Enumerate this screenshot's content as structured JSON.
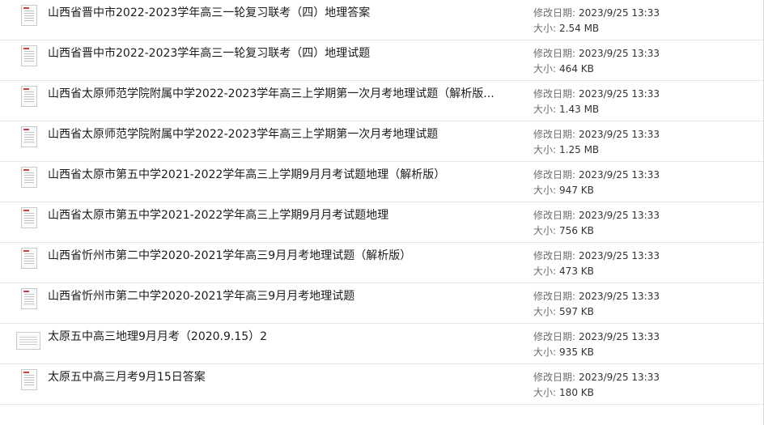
{
  "labels": {
    "modified": "修改日期:",
    "size": "大小:"
  },
  "files": [
    {
      "name": "山西省晋中市2022-2023学年高三一轮复习联考（四）地理答案",
      "modified": "2023/9/25 13:33",
      "size": "2.54 MB",
      "thumb": "page"
    },
    {
      "name": "山西省晋中市2022-2023学年高三一轮复习联考（四）地理试题",
      "modified": "2023/9/25 13:33",
      "size": "464 KB",
      "thumb": "page"
    },
    {
      "name": "山西省太原师范学院附属中学2022-2023学年高三上学期第一次月考地理试题（解析版...",
      "modified": "2023/9/25 13:33",
      "size": "1.43 MB",
      "thumb": "page"
    },
    {
      "name": "山西省太原师范学院附属中学2022-2023学年高三上学期第一次月考地理试题",
      "modified": "2023/9/25 13:33",
      "size": "1.25 MB",
      "thumb": "page"
    },
    {
      "name": "山西省太原市第五中学2021-2022学年高三上学期9月月考试题地理（解析版）",
      "modified": "2023/9/25 13:33",
      "size": "947 KB",
      "thumb": "page"
    },
    {
      "name": "山西省太原市第五中学2021-2022学年高三上学期9月月考试题地理",
      "modified": "2023/9/25 13:33",
      "size": "756 KB",
      "thumb": "page"
    },
    {
      "name": "山西省忻州市第二中学2020-2021学年高三9月月考地理试题（解析版）",
      "modified": "2023/9/25 13:33",
      "size": "473 KB",
      "thumb": "page"
    },
    {
      "name": "山西省忻州市第二中学2020-2021学年高三9月月考地理试题",
      "modified": "2023/9/25 13:33",
      "size": "597 KB",
      "thumb": "page"
    },
    {
      "name": "太原五中高三地理9月月考（2020.9.15）2",
      "modified": "2023/9/25 13:33",
      "size": "935 KB",
      "thumb": "wide"
    },
    {
      "name": "太原五中高三月考9月15日答案",
      "modified": "2023/9/25 13:33",
      "size": "180 KB",
      "thumb": "page"
    }
  ]
}
